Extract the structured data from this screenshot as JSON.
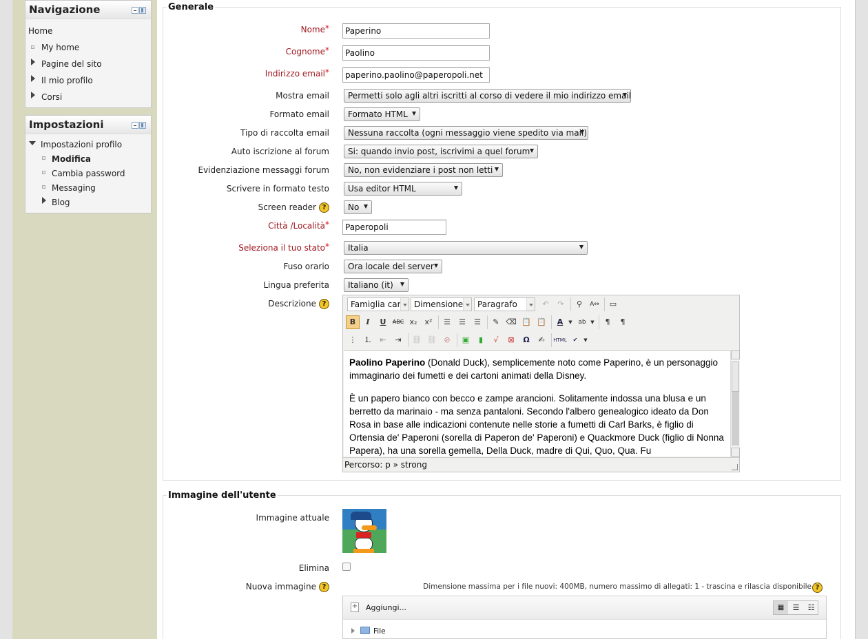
{
  "nav_block": {
    "title": "Navigazione",
    "items": [
      {
        "label": "Home",
        "kind": "plain"
      },
      {
        "label": "My home",
        "kind": "bullet"
      },
      {
        "label": "Pagine del sito",
        "kind": "collapsed"
      },
      {
        "label": "Il mio profilo",
        "kind": "collapsed"
      },
      {
        "label": "Corsi",
        "kind": "collapsed"
      }
    ]
  },
  "settings_block": {
    "title": "Impostazioni",
    "root": "Impostazioni profilo",
    "items": [
      {
        "label": "Modifica",
        "active": true
      },
      {
        "label": "Cambia password"
      },
      {
        "label": "Messaging"
      },
      {
        "label": "Blog",
        "collapsed": true
      }
    ]
  },
  "general": {
    "legend": "Generale",
    "nome": {
      "label": "Nome",
      "value": "Paperino"
    },
    "cognome": {
      "label": "Cognome",
      "value": "Paolino"
    },
    "email": {
      "label": "Indirizzo email",
      "value": "paperino.paolino@paperopoli.net"
    },
    "mostra_email": {
      "label": "Mostra email",
      "value": "Permetti solo agli altri iscritti al corso di vedere il mio indirizzo email"
    },
    "formato_email": {
      "label": "Formato email",
      "value": "Formato HTML"
    },
    "raccolta": {
      "label": "Tipo di raccolta email",
      "value": "Nessuna raccolta (ogni messaggio viene spedito via mail)"
    },
    "auto_iscrizione": {
      "label": "Auto iscrizione al forum",
      "value": "Si: quando invio post, iscrivimi a quel forum"
    },
    "evidenziazione": {
      "label": "Evidenziazione messaggi forum",
      "value": "No, non evidenziare i post non letti"
    },
    "formato_testo": {
      "label": "Scrivere in formato testo",
      "value": "Usa editor HTML"
    },
    "screen_reader": {
      "label": "Screen reader",
      "value": "No"
    },
    "citta": {
      "label": "Città /Località",
      "value": "Paperopoli"
    },
    "stato": {
      "label": "Seleziona il tuo stato",
      "value": "Italia"
    },
    "fuso": {
      "label": "Fuso orario",
      "value": "Ora locale del server"
    },
    "lingua": {
      "label": "Lingua preferita",
      "value": "Italiano (it)"
    },
    "descrizione": {
      "label": "Descrizione"
    },
    "required_mark": "*"
  },
  "editor": {
    "font_family": "Famiglia car",
    "font_size": "Dimensione",
    "format": "Paragrafo",
    "bold_name": "Paolino Paperino",
    "p1_rest": " (Donald Duck), semplicemente noto come Paperino, è un personaggio immaginario dei fumetti e dei cartoni animati della Disney.",
    "p2": "È un papero bianco con becco e zampe arancioni. Solitamente indossa una blusa e un berretto da marinaio - ma senza pantaloni. Secondo l'albero genealogico ideato da Don Rosa in base alle indicazioni contenute nelle storie a fumetti di Carl Barks, è figlio di Ortensia de' Paperoni (sorella di Paperon de' Paperoni) e Quackmore Duck (figlio di Nonna Papera), ha una sorella gemella, Della Duck, madre di Qui, Quo, Qua. Fu",
    "path_label": "Percorso: p » strong",
    "icons": {
      "bold": "B",
      "italic": "I",
      "underline": "U",
      "strike": "ABC",
      "sub": "x₂",
      "sup": "x²",
      "omega": "Ω",
      "html": "HTML"
    }
  },
  "image_section": {
    "legend": "Immagine dell'utente",
    "current_label": "Immagine attuale",
    "delete_label": "Elimina",
    "new_label": "Nuova immagine",
    "limits": "Dimensione massima per i file nuovi: 400MB, numero massimo di allegati: 1 - trascina e rilascia disponibile",
    "add_label": "Aggiungi...",
    "folder_label": "File"
  },
  "colors": {
    "required_label": "#a0171f",
    "sidebar_bg": "#d9d9c0",
    "help_icon": "#f2c52a"
  }
}
